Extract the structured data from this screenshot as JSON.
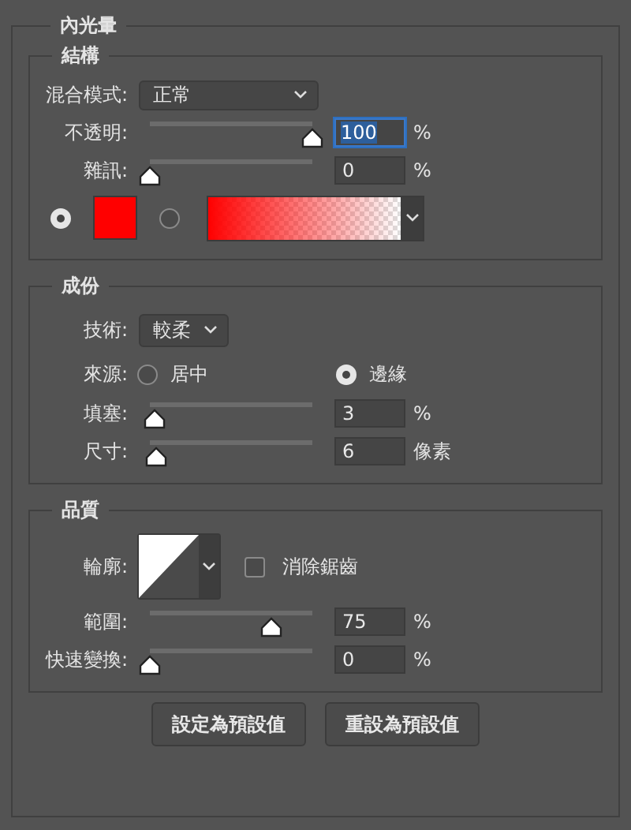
{
  "panel": {
    "title": "內光暈"
  },
  "structure": {
    "title": "結構",
    "blend_mode": {
      "label": "混合模式:",
      "value": "正常"
    },
    "sliders": [
      {
        "label": "不透明:",
        "level": 1,
        "value": "100",
        "unit": "%",
        "focused": true
      },
      {
        "label": "雜訊:",
        "level": 0,
        "value": "0",
        "unit": "%",
        "focused": false
      }
    ],
    "color_option": {
      "selected": true,
      "color": "#ff0000"
    },
    "gradient_option": {
      "selected": false
    }
  },
  "elements": {
    "title": "成份",
    "technique": {
      "label": "技術:",
      "value": "較柔"
    },
    "source": {
      "label": "來源:",
      "options": [
        {
          "label": "居中",
          "selected": false
        },
        {
          "label": "邊緣",
          "selected": true
        }
      ]
    },
    "sliders": [
      {
        "label": "填塞:",
        "level": 0.03,
        "value": "3",
        "unit": "%",
        "focused": false
      },
      {
        "label": "尺寸:",
        "level": 0.04,
        "value": "6",
        "unit": "像素",
        "focused": false
      }
    ]
  },
  "quality": {
    "title": "品質",
    "contour": {
      "label": "輪廓:"
    },
    "anti_aliased": {
      "label": "消除鋸齒",
      "checked": false
    },
    "sliders": [
      {
        "label": "範圍:",
        "level": 0.75,
        "value": "75",
        "unit": "%",
        "focused": false
      },
      {
        "label": "快速變換:",
        "level": 0,
        "value": "0",
        "unit": "%",
        "focused": false
      }
    ]
  },
  "buttons": [
    "設定為預設值",
    "重設為預設值"
  ]
}
